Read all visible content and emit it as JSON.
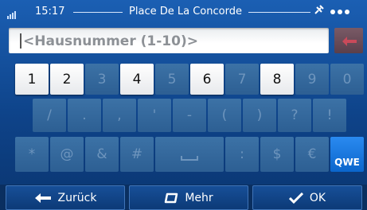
{
  "status_bar": {
    "time": "15:17",
    "title": "Place De La Concorde",
    "gps_icon": "satellite-icon",
    "page_dots": 3
  },
  "input": {
    "placeholder": "<Hausnummer (1-10)>",
    "value": ""
  },
  "keyboard": {
    "row1": [
      {
        "label": "1",
        "enabled": true
      },
      {
        "label": "2",
        "enabled": true
      },
      {
        "label": "3",
        "enabled": false
      },
      {
        "label": "4",
        "enabled": true
      },
      {
        "label": "5",
        "enabled": false
      },
      {
        "label": "6",
        "enabled": true
      },
      {
        "label": "7",
        "enabled": false
      },
      {
        "label": "8",
        "enabled": true
      },
      {
        "label": "9",
        "enabled": false
      },
      {
        "label": "0",
        "enabled": false
      }
    ],
    "row2": [
      {
        "label": "/",
        "enabled": false
      },
      {
        "label": ".",
        "enabled": false
      },
      {
        "label": ",",
        "enabled": false
      },
      {
        "label": "'",
        "enabled": false
      },
      {
        "label": "-",
        "enabled": false
      },
      {
        "label": "(",
        "enabled": false
      },
      {
        "label": ")",
        "enabled": false
      },
      {
        "label": "?",
        "enabled": false
      },
      {
        "label": "!",
        "enabled": false
      }
    ],
    "row3": [
      {
        "label": "*",
        "enabled": false
      },
      {
        "label": "@",
        "enabled": false
      },
      {
        "label": "&",
        "enabled": false
      },
      {
        "label": "#",
        "enabled": false
      },
      {
        "label": "space",
        "enabled": false
      },
      {
        "label": ":",
        "enabled": false
      },
      {
        "label": "$",
        "enabled": false
      },
      {
        "label": "€",
        "enabled": false
      }
    ],
    "layout_switch_label": "QWE",
    "backspace_icon": "backspace-arrow-icon"
  },
  "bottom_bar": {
    "back_label": "Zurück",
    "more_label": "Mehr",
    "ok_label": "OK"
  },
  "colors": {
    "background": "#0e4389",
    "key_enabled": "#ffffff",
    "key_disabled": "#2d5f93",
    "accent_qwe": "#0b66cc",
    "backspace": "#5a3f4b"
  }
}
